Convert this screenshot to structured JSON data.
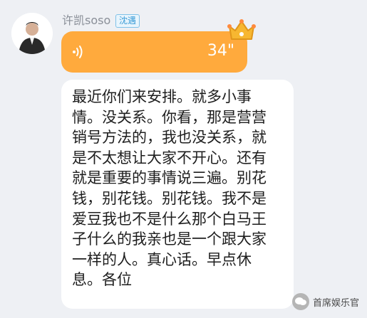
{
  "sender": {
    "name": "许凯soso",
    "badge": "沈遇"
  },
  "voice_message": {
    "duration": "34\""
  },
  "text_message": {
    "text": "最近你们来安排。就多小事\n情。没关系。你看，那是营营\n销号方法的，我也没关系，就\n是不太想让大家不开心。还有\n就是重要的事情说三遍。别花\n钱，别花钱。别花钱。我不是\n爱豆我也不是什么那个白马王\n子什么的我亲也是一个跟大家\n一样的人。真心话。早点休\n息。各位"
  },
  "watermark": {
    "text": "首席娱乐官"
  },
  "colors": {
    "voice_bubble": "#ffaa3d",
    "badge_text": "#3a9bd6",
    "background": "#eef0f4"
  }
}
